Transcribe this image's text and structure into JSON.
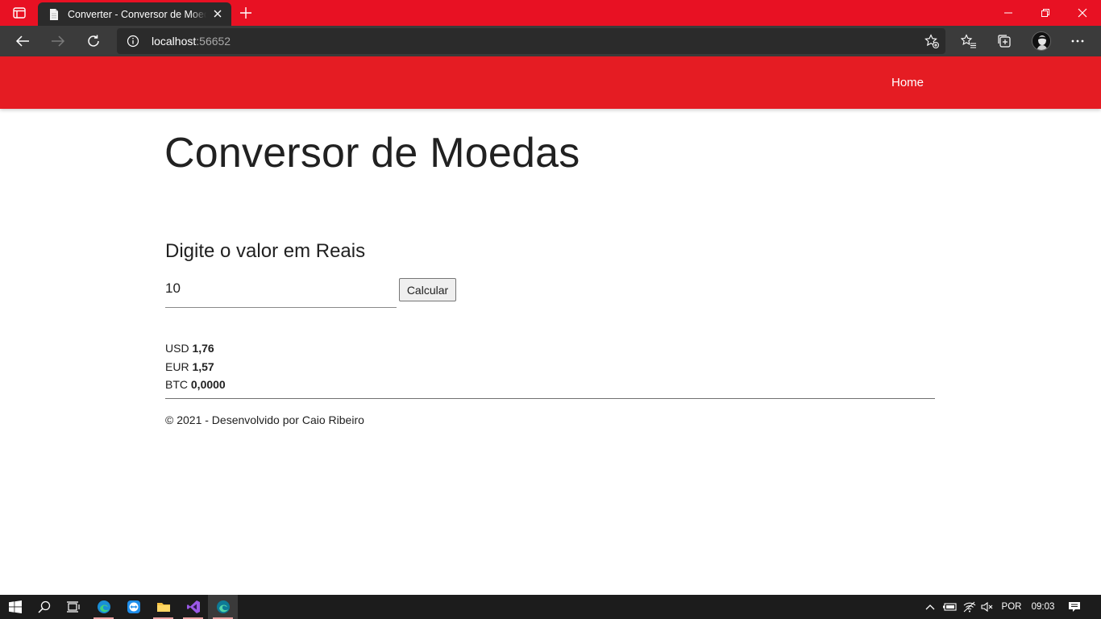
{
  "browser": {
    "tab_title": "Converter - Conversor de Moedas",
    "url_host": "localhost",
    "url_port": ":56652"
  },
  "site": {
    "nav_home": "Home",
    "title": "Conversor de Moedas",
    "input_label": "Digite o valor em Reais",
    "input_value": "10",
    "button_label": "Calcular",
    "results": [
      {
        "currency": "USD",
        "value": "1,76"
      },
      {
        "currency": "EUR",
        "value": "1,57"
      },
      {
        "currency": "BTC",
        "value": "0,0000"
      }
    ],
    "footer": "© 2021 - Desenvolvido por Caio Ribeiro"
  },
  "taskbar": {
    "language": "POR",
    "time": "09:03"
  },
  "colors": {
    "titlebar": "#e81123",
    "navbar": "#e51c23",
    "toolbar": "#3b3b3b",
    "taskbar": "#1c1c1c"
  }
}
